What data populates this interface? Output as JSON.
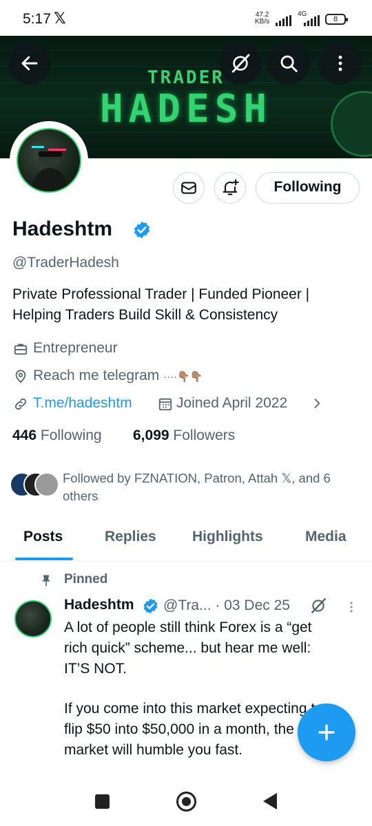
{
  "status_bar": {
    "time": "5:17",
    "x_glyph": "𝕏",
    "net_speed_value": "47.2",
    "net_speed_unit": "KB/s",
    "network": "4G",
    "battery": "8"
  },
  "header": {
    "banner_line1": "TRADER",
    "banner_line2": "HADESH",
    "back_icon": "arrow-left-icon",
    "grok_icon": "grok-slash-icon",
    "search_icon": "search-icon",
    "more_icon": "more-vertical-icon"
  },
  "profile": {
    "display_name": "Hadeshtm",
    "verified": true,
    "handle": "@TraderHadesh",
    "bio_line1": "Private Professional Trader | Funded Pioneer |",
    "bio_line2": "Helping Traders Build Skill & Consistency",
    "category": "Entrepreneur",
    "location": "Reach me telegram ",
    "location_emoji": "····👇🏽👇🏽",
    "link": "T.me/hadeshtm",
    "joined": "Joined April 2022",
    "following_count": "446",
    "following_label": "Following",
    "followers_count": "6,099",
    "followers_label": "Followers",
    "followed_by_line1": "Followed by FZNATION, Patron, Attah 𝕏, and 6",
    "followed_by_line2": "others",
    "following_button": "Following"
  },
  "tabs": [
    {
      "label": "Posts",
      "active": true
    },
    {
      "label": "Replies",
      "active": false
    },
    {
      "label": "Highlights",
      "active": false
    },
    {
      "label": "Media",
      "active": false
    }
  ],
  "pinned_post": {
    "pinned_label": "Pinned",
    "author": "Hadeshtm",
    "meta": "@Tra... · 03 Dec 25",
    "lines": [
      "A lot of people still think Forex is a “get",
      "rich quick” scheme... but hear me well:",
      "IT’S NOT.",
      "",
      "If you come into this market expecting to",
      "flip $50 into $50,000 in a month, the",
      "market will humble you fast."
    ]
  },
  "colors": {
    "accent": "#1d9bf0",
    "text": "#0f1419",
    "muted": "#536471",
    "banner_green": "#33d46f"
  }
}
